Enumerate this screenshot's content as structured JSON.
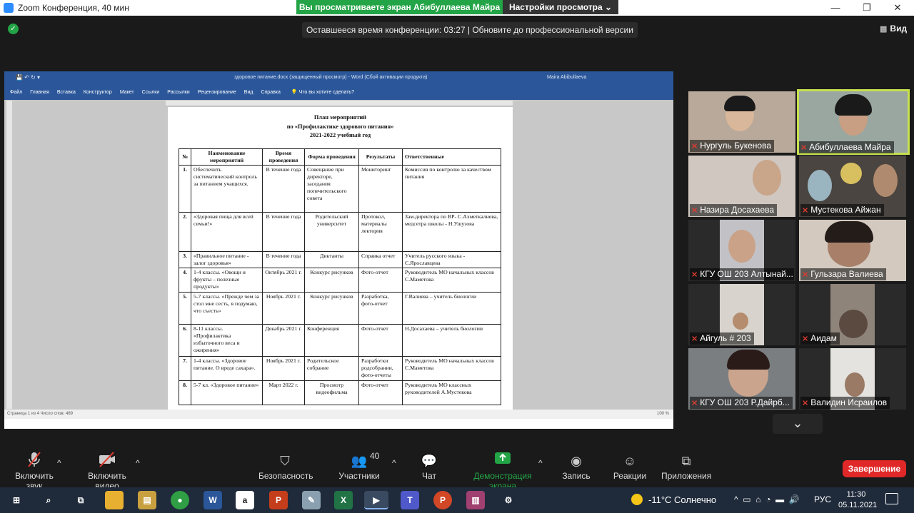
{
  "window": {
    "title": "Zoom Конференция, 40 мин",
    "minimize": "—",
    "maximize": "❐",
    "close": "✕"
  },
  "share_banner": {
    "status": "Вы просматриваете экран Абибуллаева Майра",
    "view_options": "Настройки просмотра ⌄"
  },
  "timer_text": "Оставшееся время конференции: 03:27 | Обновите до профессиональной версии",
  "view_button": "Вид",
  "word": {
    "title": "здоровое питание.docx (защищенный просмотр) - Word (Сбой активации продукта)",
    "user": "Maira Abibullaeva",
    "quick_access": "💾  ↶  ↻  ▾",
    "ribbon_tabs": [
      "Файл",
      "Главная",
      "Вставка",
      "Конструктор",
      "Макет",
      "Ссылки",
      "Рассылки",
      "Рецензирование",
      "Вид",
      "Справка"
    ],
    "tell_me": "💡  Что вы хотите сделать?",
    "status_left": "Страница 1 из 4    Число слов: 489",
    "zoom": "100 %"
  },
  "document": {
    "heading1": "План мероприятий",
    "heading2": "по «Профилактике здорового  питания»",
    "heading3": "2021-2022 учебный год",
    "columns": [
      "№",
      "Наименование мероприятий",
      "Время проведения",
      "Форма проведения",
      "Результаты",
      "Ответственные"
    ],
    "rows": [
      {
        "n": "1.",
        "name": "Обеспечить систематический контроль за питанием учащихся.",
        "time": "В течение года",
        "form": "Совещание при директоре, заседания попечительского совета",
        "result": "Мониторинг",
        "resp": "Комиссия по контролю за качеством питания"
      },
      {
        "n": "2.",
        "name": "«Здоровая пища для всей семьи!»",
        "time": "В течение года",
        "form": "Родительский университет",
        "result": "Протокол, материалы лектория",
        "resp": "Зам.директора по ВР- С.Ахметкалиева, медсетра школы  - Н.Ушузова"
      },
      {
        "n": "3.",
        "name": "«Правильное питание - залог здоровья»",
        "time": "В течение года",
        "form": "Диктанты",
        "result": "Справка отчет",
        "resp": "Учитель русского языка - С.Ярославцева"
      },
      {
        "n": "4.",
        "name": "1-4 классы. «Овощи и фрукты – полезные продукты»",
        "time": "Октябрь 2021 г.",
        "form": "Конкурс рисунков",
        "result": "Фото-отчет",
        "resp": "Руководитель  МО начальных классов С.Маметова"
      },
      {
        "n": "5.",
        "name": "5-7 классы. «Прежде чем за стол мне сесть, я подумаю, что съесть»",
        "time": "Ноябрь 2021 г.",
        "form": "Конкурс рисунков",
        "result": "Разработка, фото-отчет",
        "resp": "Г.Валиева – учитель биологии"
      },
      {
        "n": "6.",
        "name": "8-11 классы. «Профилактика избыточного веса и ожирения»",
        "time": "Декабрь 2021 г.",
        "form": "Конференция",
        "result": "Фото-отчет",
        "resp": "Н.Досахаева – учитель биологии"
      },
      {
        "n": "7.",
        "name": "1-4 классы. «Здоровое питание. О вреде сахара».",
        "time": "Ноябрь 2021 г.",
        "form": "Родительское собрание",
        "result": "Разработки родсобрании, фото-отчеты",
        "resp": "Руководитель  МО начальных классов С.Маметова"
      },
      {
        "n": "8.",
        "name": "5-7 кл. «Здоровое питание»",
        "time": "Март 2022 г.",
        "form": "Просмотр видеофильма",
        "result": "Фото-отчет",
        "resp": "Руководитель  МО классных руководителей  А.Мустекова"
      }
    ]
  },
  "participants": [
    {
      "name": "Нургуль Букенова"
    },
    {
      "name": "Абибуллаева Майра"
    },
    {
      "name": "Назира Досахаева"
    },
    {
      "name": "Мустекова Айжан"
    },
    {
      "name": "КГУ ОШ 203 Алтынай..."
    },
    {
      "name": "Гульзара Валиева"
    },
    {
      "name": "Айгуль # 203"
    },
    {
      "name": "Аидам"
    },
    {
      "name": "КГУ ОШ 203 Р.Дайрб..."
    },
    {
      "name": "Валидин Исраилов"
    }
  ],
  "toolbar": {
    "audio": "Включить звук",
    "video": "Включить видео",
    "security": "Безопасность",
    "participants": "Участники",
    "participants_count": "40",
    "chat": "Чат",
    "share": "Демонстрация экрана",
    "record": "Запись",
    "reactions": "Реакции",
    "apps": "Приложения",
    "end": "Завершение"
  },
  "taskbar": {
    "weather": "-11°C  Солнечно",
    "language": "РУС",
    "time": "11:30",
    "date": "05.11.2021"
  },
  "colors": {
    "zoom_green": "#23a446",
    "end_red": "#e02828",
    "active_speaker": "#c7e04f",
    "word_blue": "#2b579a"
  }
}
